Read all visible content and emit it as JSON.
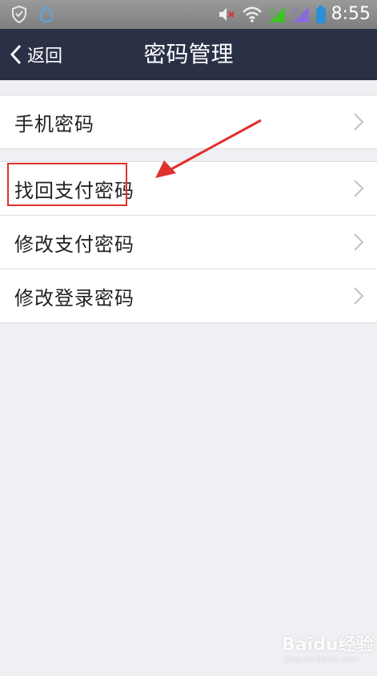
{
  "status_bar": {
    "time": "8:55",
    "icons": [
      "shield-icon",
      "notification-icon",
      "mute-icon",
      "wifi-icon",
      "signal-icon",
      "signal-icon-2",
      "battery-icon"
    ],
    "colors": {
      "signal_green": "#3fc12a",
      "signal_purple": "#8a6cd9",
      "battery_blue": "#2d8fd6"
    }
  },
  "nav": {
    "back_label": "返回",
    "title": "密码管理",
    "background": "#2a3147"
  },
  "menu": {
    "group1": [
      {
        "label": "手机密码"
      }
    ],
    "group2": [
      {
        "label": "找回支付密码"
      },
      {
        "label": "修改支付密码"
      },
      {
        "label": "修改登录密码"
      }
    ]
  },
  "annotation": {
    "color": "#e0302c"
  },
  "watermark": {
    "brand": "Baidu经验",
    "url": "jingyan.baidu.com"
  }
}
